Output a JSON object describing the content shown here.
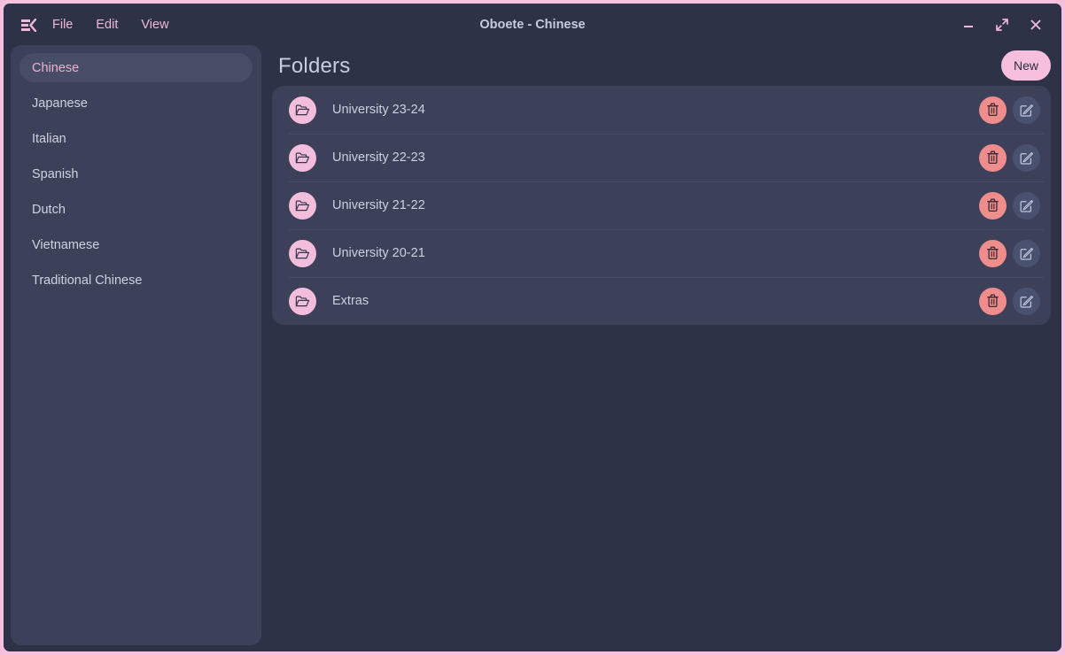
{
  "window": {
    "title": "Oboete - Chinese",
    "menu_icon": "sidebar-list-icon",
    "menus": [
      {
        "label": "File"
      },
      {
        "label": "Edit"
      },
      {
        "label": "View"
      }
    ],
    "controls": [
      {
        "name": "minimize-button",
        "glyph": "minimize-icon"
      },
      {
        "name": "maximize-button",
        "glyph": "maximize-icon"
      },
      {
        "name": "close-button",
        "glyph": "close-icon"
      }
    ]
  },
  "sidebar": {
    "items": [
      {
        "label": "Chinese",
        "selected": true
      },
      {
        "label": "Japanese",
        "selected": false
      },
      {
        "label": "Italian",
        "selected": false
      },
      {
        "label": "Spanish",
        "selected": false
      },
      {
        "label": "Dutch",
        "selected": false
      },
      {
        "label": "Vietnamese",
        "selected": false
      },
      {
        "label": "Traditional Chinese",
        "selected": false
      }
    ]
  },
  "main": {
    "title": "Folders",
    "new_button": "New",
    "folders": [
      {
        "name": "University 23-24",
        "icon": "folder-open-icon"
      },
      {
        "name": "University 22-23",
        "icon": "folder-open-icon"
      },
      {
        "name": "University 21-22",
        "icon": "folder-open-icon"
      },
      {
        "name": "University 20-21",
        "icon": "folder-open-icon"
      },
      {
        "name": "Extras",
        "icon": "folder-open-icon"
      }
    ],
    "row_actions": {
      "delete": "trash-icon",
      "edit": "edit-pencil-icon"
    }
  },
  "colors": {
    "frame": "#f6c1de",
    "app_bg": "#2e3247",
    "panel": "#3c4159",
    "accent_pink": "#f3bedc",
    "danger": "#ef8c8c",
    "text": "#cbd0e2"
  }
}
